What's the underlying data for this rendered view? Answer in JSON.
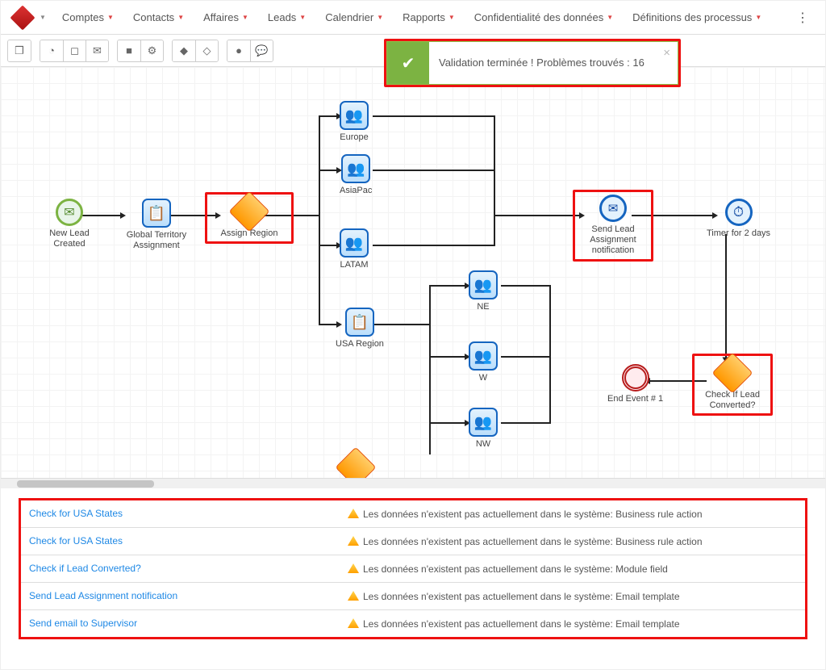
{
  "nav": {
    "items": [
      "Comptes",
      "Contacts",
      "Affaires",
      "Leads",
      "Calendrier",
      "Rapports",
      "Confidentialité des données",
      "Définitions des processus"
    ]
  },
  "toast": {
    "message": "Validation terminée ! Problèmes trouvés : 16"
  },
  "nodes": {
    "new_lead": "New Lead Created",
    "global_territory": "Global Territory Assignment",
    "assign_region": "Assign Region",
    "europe": "Europe",
    "asiapac": "AsiaPac",
    "latam": "LATAM",
    "usa_region": "USA Region",
    "ne": "NE",
    "w": "W",
    "nw": "NW",
    "send_lead": "Send Lead Assignment notification",
    "timer": "Timer for 2 days",
    "check_lead": "Check If Lead Converted?",
    "end_event": "End Event # 1"
  },
  "validations": [
    {
      "name": "Check for USA States",
      "msg": "Les données n'existent pas actuellement dans le système: Business rule action"
    },
    {
      "name": "Check for USA States",
      "msg": "Les données n'existent pas actuellement dans le système: Business rule action"
    },
    {
      "name": "Check if Lead Converted?",
      "msg": "Les données n'existent pas actuellement dans le système: Module field"
    },
    {
      "name": "Send Lead Assignment notification",
      "msg": "Les données n'existent pas actuellement dans le système: Email template"
    },
    {
      "name": "Send email to Supervisor",
      "msg": "Les données n'existent pas actuellement dans le système: Email template"
    }
  ]
}
